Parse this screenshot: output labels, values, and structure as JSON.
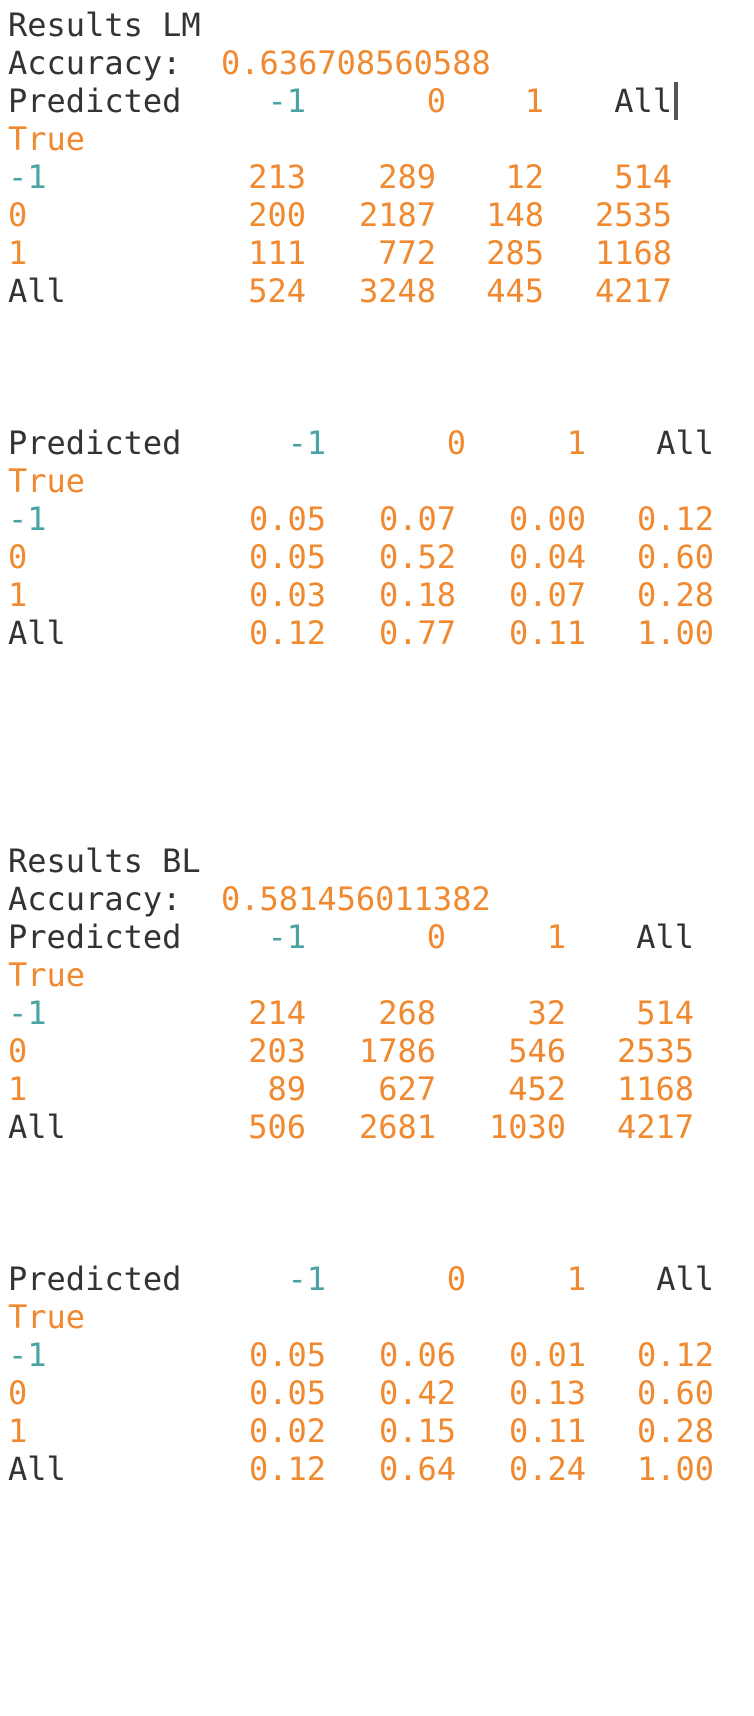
{
  "colors": {
    "text": "#333333",
    "value": "#f0892f",
    "header_index": "#4aa3a3"
  },
  "lm": {
    "title": "Results LM",
    "accuracy_label": "Accuracy:",
    "accuracy_value": "0.636708560588",
    "counts": {
      "predicted_label": "Predicted",
      "true_label": "True",
      "headers": [
        "-1",
        "0",
        "1",
        "All"
      ],
      "rows": [
        {
          "label": "-1",
          "values": [
            "213",
            "289",
            "12",
            "514"
          ]
        },
        {
          "label": "0",
          "values": [
            "200",
            "2187",
            "148",
            "2535"
          ]
        },
        {
          "label": "1",
          "values": [
            "111",
            "772",
            "285",
            "1168"
          ]
        },
        {
          "label": "All",
          "values": [
            "524",
            "3248",
            "445",
            "4217"
          ]
        }
      ]
    },
    "normalized": {
      "predicted_label": "Predicted",
      "true_label": "True",
      "headers": [
        "-1",
        "0",
        "1",
        "All"
      ],
      "rows": [
        {
          "label": "-1",
          "values": [
            "0.05",
            "0.07",
            "0.00",
            "0.12"
          ]
        },
        {
          "label": "0",
          "values": [
            "0.05",
            "0.52",
            "0.04",
            "0.60"
          ]
        },
        {
          "label": "1",
          "values": [
            "0.03",
            "0.18",
            "0.07",
            "0.28"
          ]
        },
        {
          "label": "All",
          "values": [
            "0.12",
            "0.77",
            "0.11",
            "1.00"
          ]
        }
      ]
    }
  },
  "bl": {
    "title": "Results BL",
    "accuracy_label": "Accuracy:",
    "accuracy_value": "0.581456011382",
    "counts": {
      "predicted_label": "Predicted",
      "true_label": "True",
      "headers": [
        "-1",
        "0",
        "1",
        "All"
      ],
      "rows": [
        {
          "label": "-1",
          "values": [
            "214",
            "268",
            "32",
            "514"
          ]
        },
        {
          "label": "0",
          "values": [
            "203",
            "1786",
            "546",
            "2535"
          ]
        },
        {
          "label": "1",
          "values": [
            "89",
            "627",
            "452",
            "1168"
          ]
        },
        {
          "label": "All",
          "values": [
            "506",
            "2681",
            "1030",
            "4217"
          ]
        }
      ]
    },
    "normalized": {
      "predicted_label": "Predicted",
      "true_label": "True",
      "headers": [
        "-1",
        "0",
        "1",
        "All"
      ],
      "rows": [
        {
          "label": "-1",
          "values": [
            "0.05",
            "0.06",
            "0.01",
            "0.12"
          ]
        },
        {
          "label": "0",
          "values": [
            "0.05",
            "0.42",
            "0.13",
            "0.60"
          ]
        },
        {
          "label": "1",
          "values": [
            "0.02",
            "0.15",
            "0.11",
            "0.28"
          ]
        },
        {
          "label": "All",
          "values": [
            "0.12",
            "0.64",
            "0.24",
            "1.00"
          ]
        }
      ]
    }
  }
}
